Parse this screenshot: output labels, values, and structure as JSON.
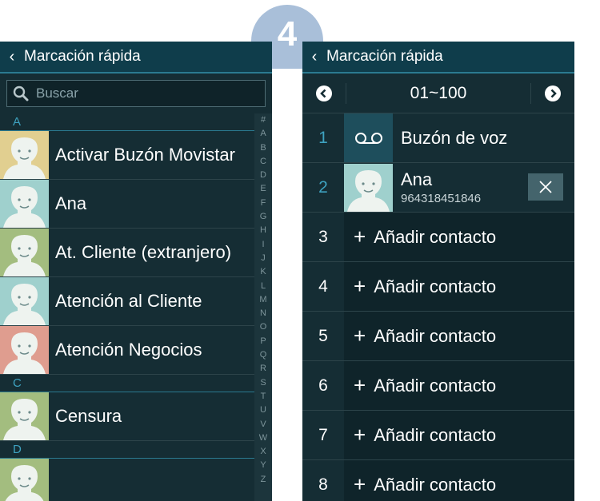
{
  "step": {
    "number": "4"
  },
  "left_screen": {
    "title": "Marcación rápida",
    "search_placeholder": "Buscar",
    "sections": [
      {
        "letter": "A",
        "contacts": [
          {
            "name": "Activar Buzón Movistar",
            "avatar_color": "#e1cf90"
          },
          {
            "name": "Ana",
            "avatar_color": "#9fd0cd"
          },
          {
            "name": "At. Cliente (extranjero)",
            "avatar_color": "#a3bd7f"
          },
          {
            "name": "Atención al Cliente",
            "avatar_color": "#9fd0cd"
          },
          {
            "name": "Atención Negocios",
            "avatar_color": "#df9d8f"
          }
        ]
      },
      {
        "letter": "C",
        "contacts": [
          {
            "name": "Censura",
            "avatar_color": "#a3bd7f"
          }
        ]
      },
      {
        "letter": "D",
        "contacts": []
      }
    ],
    "index_letters": [
      "#",
      "A",
      "B",
      "C",
      "D",
      "E",
      "F",
      "G",
      "H",
      "I",
      "J",
      "K",
      "L",
      "M",
      "N",
      "O",
      "P",
      "Q",
      "R",
      "S",
      "T",
      "U",
      "V",
      "W",
      "X",
      "Y",
      "Z"
    ]
  },
  "right_screen": {
    "title": "Marcación rápida",
    "range": "01~100",
    "voicemail": {
      "number": "1",
      "label": "Buzón de voz"
    },
    "assigned": {
      "number": "2",
      "name": "Ana",
      "phone": "964318451846",
      "avatar_color": "#9fd0cd"
    },
    "empty_slots": [
      {
        "number": "3",
        "label": "Añadir contacto"
      },
      {
        "number": "4",
        "label": "Añadir contacto"
      },
      {
        "number": "5",
        "label": "Añadir contacto"
      },
      {
        "number": "6",
        "label": "Añadir contacto"
      },
      {
        "number": "7",
        "label": "Añadir contacto"
      },
      {
        "number": "8",
        "label": "Añadir contacto"
      }
    ]
  },
  "colors": {
    "background": "#152d34",
    "titlebar": "#0f3d4b",
    "accent": "#3ea2c0"
  }
}
